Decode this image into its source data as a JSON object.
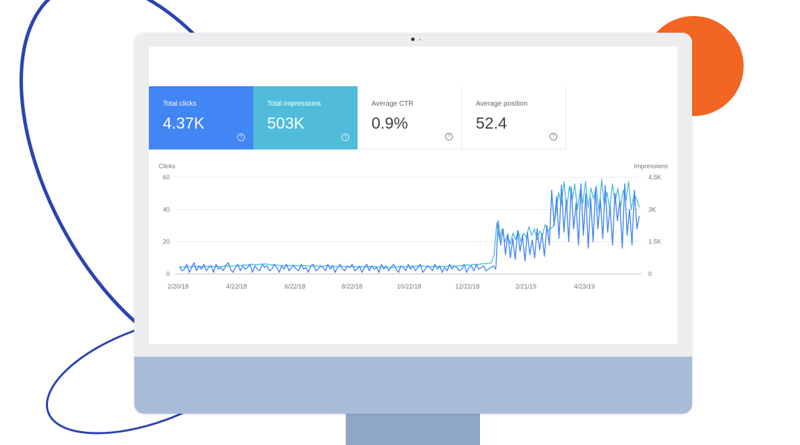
{
  "colors": {
    "clicks": "#4285f4",
    "impressions": "#50bcd9",
    "decor_ring": "#2b44b0",
    "decor_circle": "#f26522"
  },
  "metrics": [
    {
      "label": "Total clicks",
      "value": "4.37K"
    },
    {
      "label": "Total impressions",
      "value": "503K"
    },
    {
      "label": "Average CTR",
      "value": "0.9%"
    },
    {
      "label": "Average position",
      "value": "52.4"
    }
  ],
  "help_glyph": "?",
  "chart_data": {
    "type": "line",
    "ylabel": "Clicks",
    "y2label": "Impressions",
    "ylim": [
      0,
      60
    ],
    "y2lim": [
      0,
      4500
    ],
    "yticks": [
      "60",
      "40",
      "20",
      "0"
    ],
    "y2ticks": [
      "4.5K",
      "3K",
      "1.5K",
      "0"
    ],
    "xticks": [
      "2/20/18",
      "4/22/18",
      "6/22/18",
      "8/22/18",
      "10/22/18",
      "12/22/18",
      "2/21/19",
      "4/23/19"
    ],
    "x_range_days": [
      0,
      500
    ],
    "grid": true,
    "series": [
      {
        "name": "Clicks",
        "axis": "left",
        "values": [
          5,
          2,
          3,
          6,
          1,
          4,
          7,
          2,
          5,
          3,
          6,
          2,
          4,
          5,
          1,
          6,
          3,
          4,
          2,
          5,
          7,
          3,
          1,
          4,
          6,
          2,
          5,
          3,
          4,
          6,
          1,
          5,
          3,
          2,
          6,
          4,
          5,
          2,
          3,
          6,
          4,
          1,
          5,
          3,
          6,
          2,
          4,
          5,
          3,
          2,
          6,
          3,
          4,
          1,
          5,
          6,
          2,
          3,
          5,
          4,
          2,
          6,
          3,
          5,
          1,
          4,
          6,
          3,
          2,
          5,
          4,
          6,
          2,
          3,
          5,
          1,
          4,
          6,
          2,
          5,
          3,
          4,
          1,
          6,
          3,
          5,
          2,
          4,
          6,
          3,
          1,
          5,
          4,
          2,
          6,
          3,
          5,
          2,
          4,
          6,
          1,
          3,
          5,
          4,
          2,
          6,
          3,
          5,
          1,
          4,
          2,
          6,
          3,
          5,
          4,
          2,
          3,
          6,
          1,
          4,
          5,
          2,
          6,
          3,
          4,
          5,
          2,
          3,
          4,
          5,
          3,
          33,
          18,
          28,
          12,
          25,
          10,
          22,
          9,
          27,
          14,
          24,
          8,
          26,
          12,
          21,
          10,
          28,
          15,
          25,
          11,
          30,
          18,
          52,
          30,
          48,
          22,
          55,
          26,
          46,
          20,
          54,
          28,
          44,
          18,
          56,
          24,
          50,
          16,
          47,
          20,
          53,
          28,
          46,
          22,
          55,
          26,
          42,
          18,
          50,
          33,
          45,
          16,
          56,
          24,
          40,
          18,
          52,
          28,
          36
        ]
      },
      {
        "name": "Impressions",
        "axis": "right",
        "values": [
          300,
          320,
          330,
          310,
          340,
          350,
          330,
          360,
          340,
          320,
          350,
          370,
          360,
          330,
          350,
          340,
          360,
          380,
          370,
          350,
          360,
          390,
          380,
          400,
          420,
          410,
          430,
          450,
          440,
          420,
          460,
          450,
          470,
          440,
          420,
          430,
          410,
          400,
          390,
          380,
          400,
          390,
          410,
          400,
          380,
          370,
          390,
          380,
          370,
          360,
          350,
          380,
          370,
          360,
          380,
          390,
          370,
          360,
          350,
          340,
          360,
          350,
          340,
          330,
          350,
          340,
          330,
          320,
          340,
          330,
          320,
          340,
          330,
          350,
          320,
          310,
          330,
          320,
          310,
          300,
          320,
          330,
          340,
          350,
          330,
          340,
          360,
          350,
          370,
          360,
          380,
          370,
          360,
          340,
          350,
          330,
          360,
          340,
          350,
          370,
          360,
          380,
          350,
          360,
          390,
          380,
          400,
          420,
          410,
          430,
          450,
          440,
          460,
          480,
          470,
          500,
          520,
          900,
          2400,
          1600,
          2100,
          1500,
          1800,
          1400,
          1900,
          1600,
          2000,
          1500,
          1900,
          1700,
          2200,
          1800,
          2100,
          1600,
          2000,
          1800,
          2300,
          2000,
          2100,
          2200,
          2800,
          3800,
          3200,
          4300,
          3000,
          4100,
          3400,
          4200,
          3000,
          3900,
          3300,
          4300,
          3100,
          4000,
          3500,
          4100,
          2900,
          4400,
          3200,
          3800,
          3000,
          4200,
          3300,
          4000,
          3100,
          3900,
          3400,
          4300,
          3000,
          3700,
          3500,
          3100
        ]
      }
    ]
  }
}
